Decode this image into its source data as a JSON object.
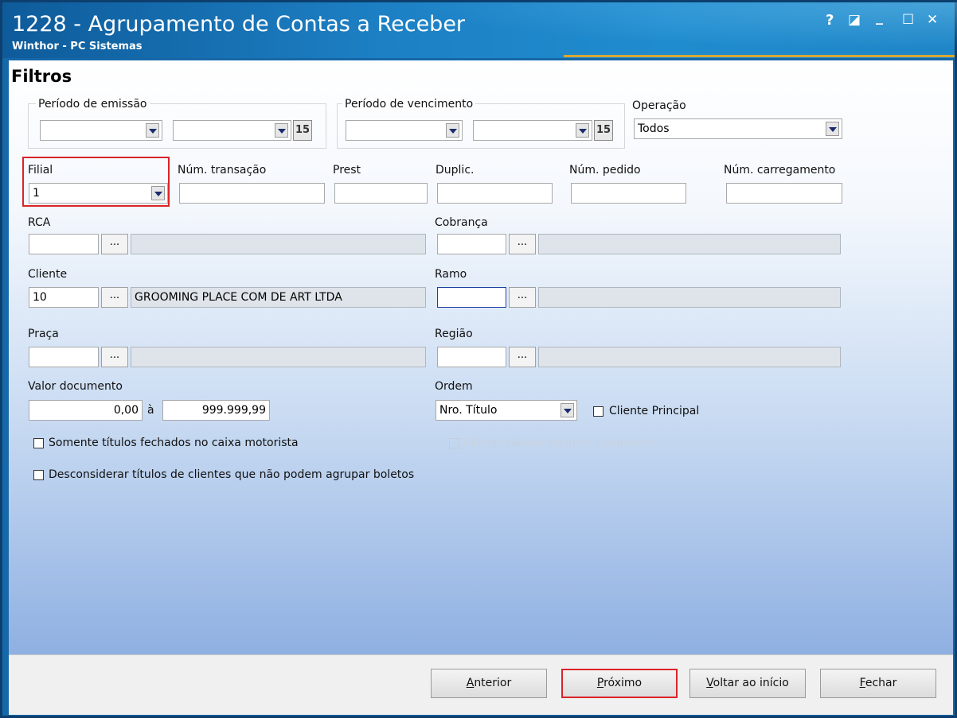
{
  "window": {
    "title": "1228 - Agrupamento de Contas a Receber",
    "subtitle": "Winthor - PC Sistemas",
    "help": "?",
    "restore": "◪",
    "minimize": "_",
    "maximize": "☐",
    "close": "✕"
  },
  "heading": "Filtros",
  "periodo_emissao": {
    "label": "Período de emissão",
    "start": "",
    "end": ""
  },
  "periodo_vencimento": {
    "label": "Período de vencimento",
    "start": "",
    "end": ""
  },
  "operacao": {
    "label": "Operação",
    "value": "Todos"
  },
  "filial": {
    "label": "Filial",
    "value": "1"
  },
  "num_transacao": {
    "label": "Núm. transação",
    "value": ""
  },
  "prest": {
    "label": "Prest",
    "value": ""
  },
  "duplic": {
    "label": "Duplic.",
    "value": ""
  },
  "num_pedido": {
    "label": "Núm. pedido",
    "value": ""
  },
  "num_carregamento": {
    "label": "Núm. carregamento",
    "value": ""
  },
  "rca": {
    "label": "RCA",
    "code": "",
    "desc": ""
  },
  "cobranca": {
    "label": "Cobrança",
    "code": "",
    "desc": ""
  },
  "cliente": {
    "label": "Cliente",
    "code": "10",
    "desc": "GROOMING PLACE COM DE ART LTDA"
  },
  "ramo": {
    "label": "Ramo",
    "code": "",
    "desc": ""
  },
  "praca": {
    "label": "Praça",
    "code": "",
    "desc": ""
  },
  "regiao": {
    "label": "Região",
    "code": "",
    "desc": ""
  },
  "valor_documento": {
    "label": "Valor documento",
    "min": "0,00",
    "sep": "à",
    "max": "999.999,99"
  },
  "ordem": {
    "label": "Ordem",
    "value": "Nro. Título"
  },
  "checkboxes": {
    "cliente_principal": "Cliente Principal",
    "somente_fechados": "Somente títulos fechados no caixa motorista",
    "juros_compostos": "Utilizar cálculo de juros compostos",
    "desconsiderar": "Desconsiderar títulos de clientes que não podem agrupar boletos"
  },
  "ellipsis": "...",
  "calendar_glyph": "15",
  "buttons": {
    "anterior_u": "A",
    "anterior_rest": "nterior",
    "proximo_u": "P",
    "proximo_rest": "róximo",
    "voltar_u": "V",
    "voltar_rest": "oltar ao início",
    "fechar_u": "F",
    "fechar_rest": "echar"
  },
  "colors": {
    "title_bar": "#1d80c4",
    "accent_line": "#d6a733",
    "highlight": "#d9242a"
  }
}
